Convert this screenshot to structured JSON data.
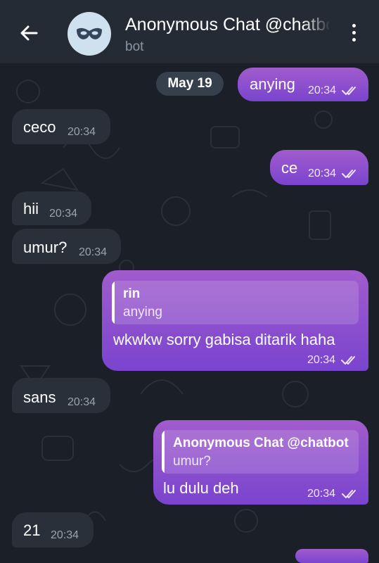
{
  "header": {
    "title": "Anonymous Chat @chatbot",
    "subtitle": "bot",
    "icons": {
      "back": "arrow-left-icon",
      "avatar": "mask-icon",
      "menu": "more-vertical-icon"
    }
  },
  "date_chip": "May 19",
  "colors": {
    "incoming_bubble": "#2a3039",
    "outgoing_bubble_top": "#a15ccc",
    "outgoing_bubble_bottom": "#7a44cf",
    "header": "#242b35",
    "background": "#1a1f28"
  },
  "messages": [
    {
      "direction": "out",
      "text": "anying",
      "time": "20:34",
      "status": "read"
    },
    {
      "direction": "in",
      "text": "ceco",
      "time": "20:34"
    },
    {
      "direction": "out",
      "text": "ce",
      "time": "20:34",
      "status": "read"
    },
    {
      "direction": "in",
      "text": "hii",
      "time": "20:34"
    },
    {
      "direction": "in",
      "text": "umur?",
      "time": "20:34"
    },
    {
      "direction": "out",
      "reply_name": "rin",
      "reply_text": "anying",
      "text": "wkwkw sorry gabisa ditarik haha",
      "time": "20:34",
      "status": "read"
    },
    {
      "direction": "in",
      "text": "sans",
      "time": "20:34"
    },
    {
      "direction": "out",
      "reply_name": "Anonymous Chat @chatbot",
      "reply_text": "umur?",
      "text": "lu dulu deh",
      "time": "20:34",
      "status": "read"
    },
    {
      "direction": "in",
      "text": "21",
      "time": "20:34"
    }
  ]
}
